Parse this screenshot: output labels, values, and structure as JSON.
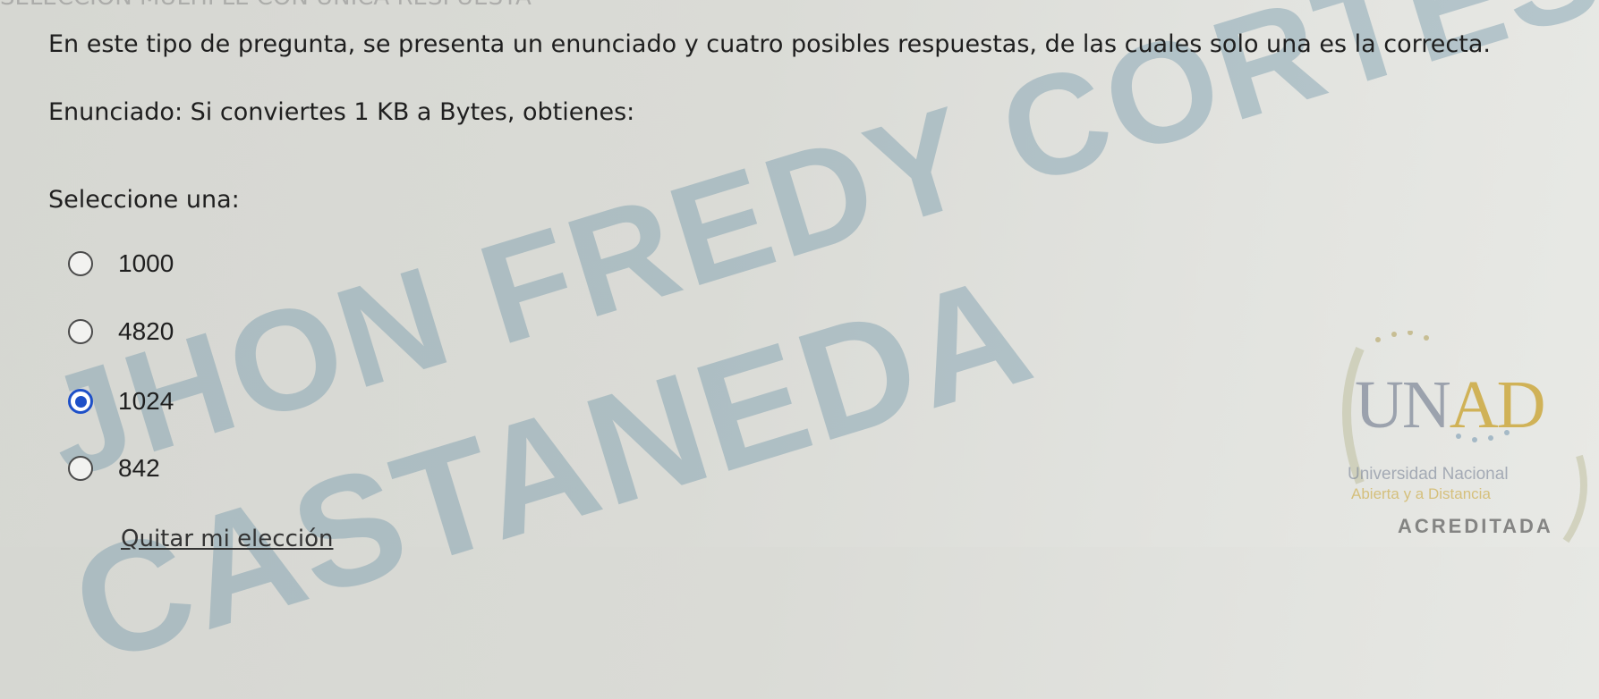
{
  "header": {
    "clipped_text": "SELECCIÓN MÚLTIPLE CON ÚNICA RESPUESTA"
  },
  "question": {
    "intro": "En este tipo de pregunta, se presenta un enunciado y cuatro posibles respuestas, de las cuales solo una es la correcta.",
    "statement": "Enunciado: Si conviertes 1 KB a Bytes, obtienes:",
    "prompt": "Seleccione una:",
    "options": [
      {
        "label": "1000",
        "selected": false
      },
      {
        "label": "4820",
        "selected": false
      },
      {
        "label": "1024",
        "selected": true
      },
      {
        "label": "842",
        "selected": false
      }
    ],
    "clear_label": "Quitar mi elección"
  },
  "watermark": {
    "line1": "JHON FREDY CORTES",
    "line2": "CASTANEDA",
    "color": "#7096aa"
  },
  "logo": {
    "letters_main": "UN",
    "letters_accent": "AD",
    "line1": "Universidad Nacional",
    "line2": "Abierta y a Distancia",
    "line3": "ACREDITADA"
  },
  "colors": {
    "selected_radio": "#1e50c8",
    "background": "#d8d9d4"
  }
}
